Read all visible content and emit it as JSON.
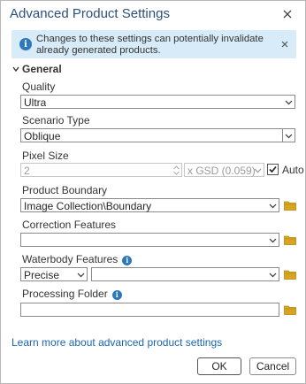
{
  "window": {
    "title": "Advanced Product Settings"
  },
  "banner": {
    "text": "Changes to these settings can potentially invalidate already generated products."
  },
  "group": {
    "label": "General"
  },
  "fields": {
    "quality": {
      "label": "Quality",
      "value": "Ultra"
    },
    "scenario_type": {
      "label": "Scenario Type",
      "value": "Oblique"
    },
    "pixel_size": {
      "label": "Pixel Size",
      "value": "2",
      "unit": "x GSD (0.059)",
      "auto_label": "Auto",
      "auto_checked": true
    },
    "product_boundary": {
      "label": "Product Boundary",
      "value": "Image Collection\\Boundary"
    },
    "correction_features": {
      "label": "Correction Features",
      "value": ""
    },
    "waterbody_features": {
      "label": "Waterbody Features",
      "mode": "Precise",
      "value": ""
    },
    "processing_folder": {
      "label": "Processing Folder",
      "value": ""
    }
  },
  "link": {
    "text": "Learn more about advanced product settings"
  },
  "buttons": {
    "ok": "OK",
    "cancel": "Cancel"
  },
  "colors": {
    "accent": "#2d78bb",
    "title": "#2b4f7a",
    "banner_bg": "#d7ebf8",
    "link": "#1a66b0",
    "folder": "#d9a520"
  }
}
